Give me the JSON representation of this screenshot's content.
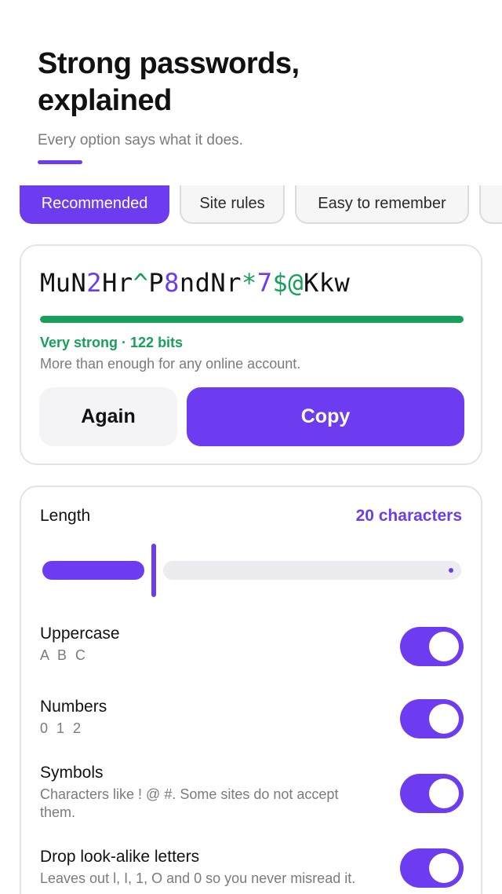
{
  "header": {
    "title_line1": "Strong passwords,",
    "title_line2": "explained",
    "subtitle": "Every option says what it does."
  },
  "tabs": [
    {
      "label": "Recommended",
      "active": true
    },
    {
      "label": "Site rules",
      "active": false
    },
    {
      "label": "Easy to remember",
      "active": false
    },
    {
      "label": "",
      "active": false
    }
  ],
  "generator": {
    "password_segments": [
      {
        "text": "MuN",
        "kind": "letter"
      },
      {
        "text": "2",
        "kind": "digit"
      },
      {
        "text": "Hr",
        "kind": "letter"
      },
      {
        "text": "^",
        "kind": "symbol"
      },
      {
        "text": "P",
        "kind": "letter"
      },
      {
        "text": "8",
        "kind": "digit"
      },
      {
        "text": "ndNr",
        "kind": "letter"
      },
      {
        "text": "*",
        "kind": "symbol"
      },
      {
        "text": "7",
        "kind": "digit"
      },
      {
        "text": "$@",
        "kind": "symbol"
      },
      {
        "text": "Kkw",
        "kind": "letter"
      }
    ],
    "strength_fraction": 1.0,
    "strength_label": "Very strong · 122 bits",
    "strength_description": "More than enough for any online account.",
    "again_label": "Again",
    "copy_label": "Copy"
  },
  "options": {
    "length_label": "Length",
    "length_value": "20 characters",
    "length_slider_fraction": 0.26,
    "toggles": [
      {
        "title": "Uppercase",
        "description": "A B C",
        "on": true
      },
      {
        "title": "Numbers",
        "description": "0 1 2",
        "on": true
      },
      {
        "title": "Symbols",
        "description": "Characters like ! @ #. Some sites do not accept them.",
        "on": true
      },
      {
        "title": "Drop look-alike letters",
        "description": "Leaves out l, I, 1, O and 0 so you never misread it.",
        "on": true
      }
    ]
  },
  "colors": {
    "accent": "#6d3cf0",
    "strong": "#16a05a",
    "muted_text": "#7a7a82"
  }
}
